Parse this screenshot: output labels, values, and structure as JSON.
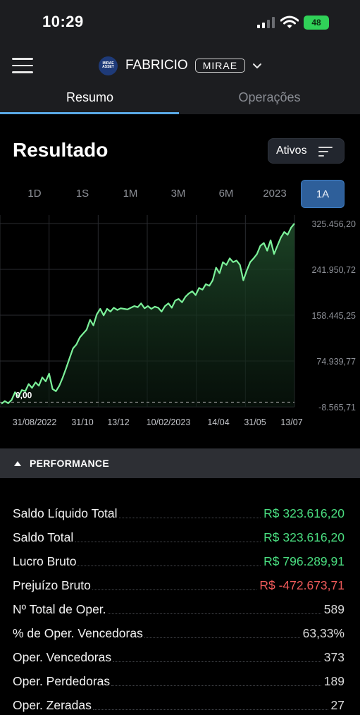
{
  "status_bar": {
    "time": "10:29",
    "battery": "48"
  },
  "header": {
    "account_logo_text": "MIRAE ASSET",
    "account_name": "FABRICIO",
    "account_tag": "MIRAE"
  },
  "tabs": [
    {
      "label": "Resumo",
      "active": true
    },
    {
      "label": "Operações",
      "active": false
    }
  ],
  "section_title": "Resultado",
  "filter_button": "Ativos",
  "periods": [
    {
      "label": "1D",
      "active": false
    },
    {
      "label": "1S",
      "active": false
    },
    {
      "label": "1M",
      "active": false
    },
    {
      "label": "3M",
      "active": false
    },
    {
      "label": "6M",
      "active": false
    },
    {
      "label": "2023",
      "active": false
    },
    {
      "label": "1A",
      "active": true
    }
  ],
  "chart_data": {
    "type": "area",
    "y_ticks": [
      "325.456,20",
      "241.950,72",
      "158.445,25",
      "74.939,77",
      "-8.565,71"
    ],
    "x_ticks": [
      "31/08/2022",
      "31/10",
      "13/12",
      "10/02/2023",
      "14/04",
      "31/05",
      "13/07"
    ],
    "ylim": [
      -8565.71,
      325456.2
    ],
    "start_label": "0,00",
    "line_color": "#7cf29a",
    "fill_color": "#1f4a2a",
    "series": [
      {
        "values": [
          -3000,
          2000,
          -2000,
          4000,
          18000,
          10000,
          22000,
          20000,
          33000,
          26000,
          36000,
          30000,
          45000,
          38000,
          52000,
          24000,
          20000,
          30000,
          45000,
          62000,
          80000,
          98000,
          105000,
          118000,
          125000,
          132000,
          150000,
          140000,
          160000,
          170000,
          158000,
          170000,
          165000,
          172000,
          168000,
          171000,
          170000,
          169000,
          172000,
          175000,
          173000,
          180000,
          171000,
          175000,
          170000,
          174000,
          172000,
          165000,
          175000,
          180000,
          172000,
          185000,
          188000,
          182000,
          192000,
          198000,
          202000,
          195000,
          208000,
          205000,
          215000,
          212000,
          222000,
          245000,
          235000,
          255000,
          250000,
          262000,
          255000,
          258000,
          250000,
          222000,
          240000,
          255000,
          262000,
          270000,
          285000,
          290000,
          276000,
          295000,
          270000,
          285000,
          300000,
          310000,
          305000,
          318000,
          325456
        ]
      }
    ]
  },
  "performance": {
    "title": "PERFORMANCE",
    "rows": [
      {
        "label": "Saldo Líquido Total",
        "value": "R$ 323.616,20",
        "tone": "pos"
      },
      {
        "label": "Saldo Total",
        "value": "R$ 323.616,20",
        "tone": "pos"
      },
      {
        "label": "Lucro Bruto",
        "value": "R$ 796.289,91",
        "tone": "pos"
      },
      {
        "label": "Prejuízo Bruto",
        "value": "R$ -472.673,71",
        "tone": "neg"
      },
      {
        "label": "Nº Total de Oper.",
        "value": "589",
        "tone": "neutral"
      },
      {
        "label": " % de Oper. Vencedoras",
        "value": "63,33%",
        "tone": "neutral"
      },
      {
        "label": "Oper. Vencedoras",
        "value": "373",
        "tone": "neutral"
      },
      {
        "label": "Oper. Perdedoras",
        "value": "189",
        "tone": "neutral"
      },
      {
        "label": "Oper. Zeradas",
        "value": "27",
        "tone": "neutral"
      }
    ]
  }
}
